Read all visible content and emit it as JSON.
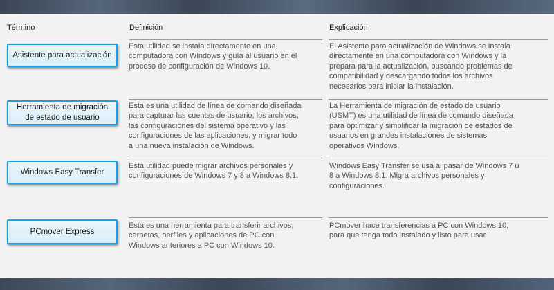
{
  "headers": {
    "term": "Término",
    "definition": "Definición",
    "explanation": "Explicación"
  },
  "rows": [
    {
      "term": "Asistente para actualización",
      "definition": "Esta utilidad se instala directamente en una\ncomputadora con Windows y guía al usuario en el\nproceso de configuración de Windows 10.",
      "explanation": "El Asistente para actualización de Windows se instala\ndirectamente en una computadora con Windows y la\nprepara para la actualización, buscando problemas de\ncompatibilidad y descargando todos los archivos\nnecesarios para iniciar la instalación."
    },
    {
      "term": "Herramienta de migración\nde estado de usuario",
      "definition": "Esta es una utilidad de línea de comando diseñada\npara capturar las cuentas de usuario, los archivos,\nlas configuraciones del sistema operativo y las\nconfiguraciones de las aplicaciones, y migrar todo\na una nueva instalación de Windows.",
      "explanation": "La Herramienta de migración de estado de usuario\n(USMT) es una utilidad de línea de comando diseñada\npara optimizar y simplificar la migración de estados de\nusuarios en grandes instalaciones de sistemas\noperativos Windows."
    },
    {
      "term": "Windows Easy Transfer",
      "definition": "Esta utilidad puede migrar archivos personales y\nconfiguraciones de Windows 7 y 8 a Windows 8.1.",
      "explanation": "Windows Easy Transfer se usa al pasar de Windows 7 u\n8 a Windows 8.1. Migra archivos personales y\nconfiguraciones."
    },
    {
      "term": "PCmover Express",
      "definition": "Esta es una herramienta para transferir archivos,\ncarpetas, perfiles y aplicaciones de PC con\nWindows anteriores a PC con Windows 10.",
      "explanation": "PCmover hace transferencias a PC con Windows 10,\npara que tenga todo instalado y listo para usar."
    }
  ]
}
